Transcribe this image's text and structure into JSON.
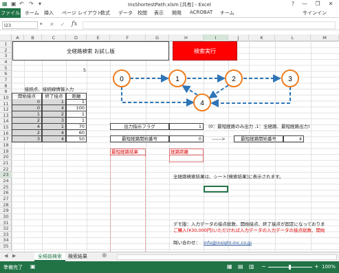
{
  "window": {
    "title": "InsShortestPath.xlsm [共有] - Excel",
    "minimize": "—",
    "restore": "❐",
    "close": "✕",
    "help": "?"
  },
  "ribbon": {
    "tabs": [
      "ファイル",
      "ホーム",
      "挿入",
      "ページ レイアウト",
      "数式",
      "データ",
      "校閲",
      "表示",
      "開発",
      "ACROBAT",
      "チーム"
    ],
    "signin": "サインイン"
  },
  "formula_bar": {
    "name_box": "I23",
    "fx": "fx",
    "formula": ""
  },
  "columns": [
    "A",
    "B",
    "C",
    "D",
    "E",
    "F",
    "G",
    "H",
    "I",
    "J",
    "K",
    "L",
    "M"
  ],
  "rows": [
    "1",
    "2",
    "3",
    "4",
    "5",
    "6",
    "7",
    "8",
    "9",
    "10",
    "11",
    "12",
    "13",
    "14",
    "15",
    "16",
    "17",
    "18",
    "19",
    "20",
    "21",
    "22",
    "23",
    "24",
    "25",
    "26",
    "27",
    "28",
    "29",
    "30",
    "31",
    "32",
    "33",
    "34",
    "35"
  ],
  "sheet": {
    "title_cell": "全経路検索 お試し版",
    "run_button": "検索実行",
    "d4_value": "5",
    "edge_table": {
      "header": "接続点、接続線情報入力",
      "columns": [
        "開始接点",
        "終了接点",
        "距離"
      ],
      "rows": [
        [
          "0",
          "1",
          "1"
        ],
        [
          "0",
          "4",
          "100"
        ],
        [
          "1",
          "2",
          "1"
        ],
        [
          "2",
          "3",
          "1"
        ],
        [
          "4",
          "1",
          "70"
        ],
        [
          "2",
          "4",
          "60"
        ],
        [
          "3",
          "4",
          "50"
        ]
      ]
    },
    "output_flag_label": "出力指示フラグ",
    "output_flag_value": "1",
    "output_flag_note": "(0：最短経路のみ出力 ,1：全経路、最短経路出力)",
    "shortest_start_label": "最短経路開始番号",
    "shortest_start_value": "0",
    "arrow_text": "------>",
    "shortest_end_label": "最短経路開始番号",
    "shortest_end_value": "4",
    "result_header": "最短経路結果",
    "distance_header": "経路距離",
    "note_text": "全経路検索結果は、シート[検索結果]に表示されます。",
    "demo_note": "デモ版：入力データの接点総数、開始接点、終了接点が固定になっておりま",
    "purchase_note": "ご購入(¥30,000円)いただければ入力データの入力データの接点総数、開始",
    "contact_label": "問い合わせ：",
    "contact_email": "info@insight-inc.co.jp"
  },
  "graph": {
    "nodes": [
      "0",
      "1",
      "2",
      "3",
      "4"
    ]
  },
  "sheet_tabs": [
    "全経路検索",
    "検索結果"
  ],
  "status": {
    "ready": "準備完了",
    "zoom": "100%"
  },
  "colors": {
    "excel_green": "#217346",
    "run_button": "#ff0000",
    "graph_orange": "#f07c1e",
    "graph_blue": "#2e75b6"
  }
}
